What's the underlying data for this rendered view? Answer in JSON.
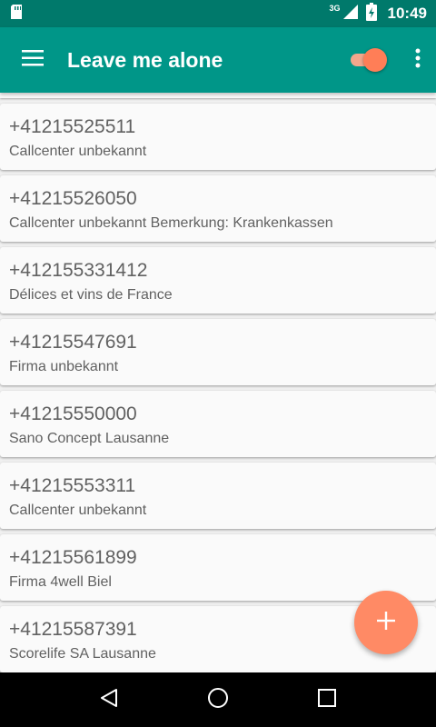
{
  "status_bar": {
    "network": "3G",
    "time": "10:49"
  },
  "app_bar": {
    "title": "Leave me alone",
    "toggle_on": true
  },
  "contacts": [
    {
      "number": "+41215525511",
      "name": "Callcenter unbekannt"
    },
    {
      "number": "+41215526050",
      "name": "Callcenter unbekannt Bemerkung: Krankenkassen"
    },
    {
      "number": "+412155331412",
      "name": "Délices et vins de France"
    },
    {
      "number": "+41215547691",
      "name": "Firma unbekannt"
    },
    {
      "number": "+41215550000",
      "name": "Sano Concept Lausanne"
    },
    {
      "number": "+41215553311",
      "name": "Callcenter unbekannt"
    },
    {
      "number": "+41215561899",
      "name": "Firma 4well Biel"
    },
    {
      "number": "+41215587391",
      "name": "Scorelife SA Lausanne"
    }
  ],
  "colors": {
    "primary": "#009688",
    "primary_dark": "#00796b",
    "accent": "#ff8a65"
  },
  "icons": {
    "status_left": "sd-card-icon",
    "status_right": [
      "signal-icon",
      "battery-charging-icon"
    ],
    "menu": "hamburger-menu-icon",
    "overflow": "more-vert-icon",
    "fab": "add-icon",
    "nav": [
      "back-icon",
      "home-icon",
      "recents-icon"
    ]
  }
}
